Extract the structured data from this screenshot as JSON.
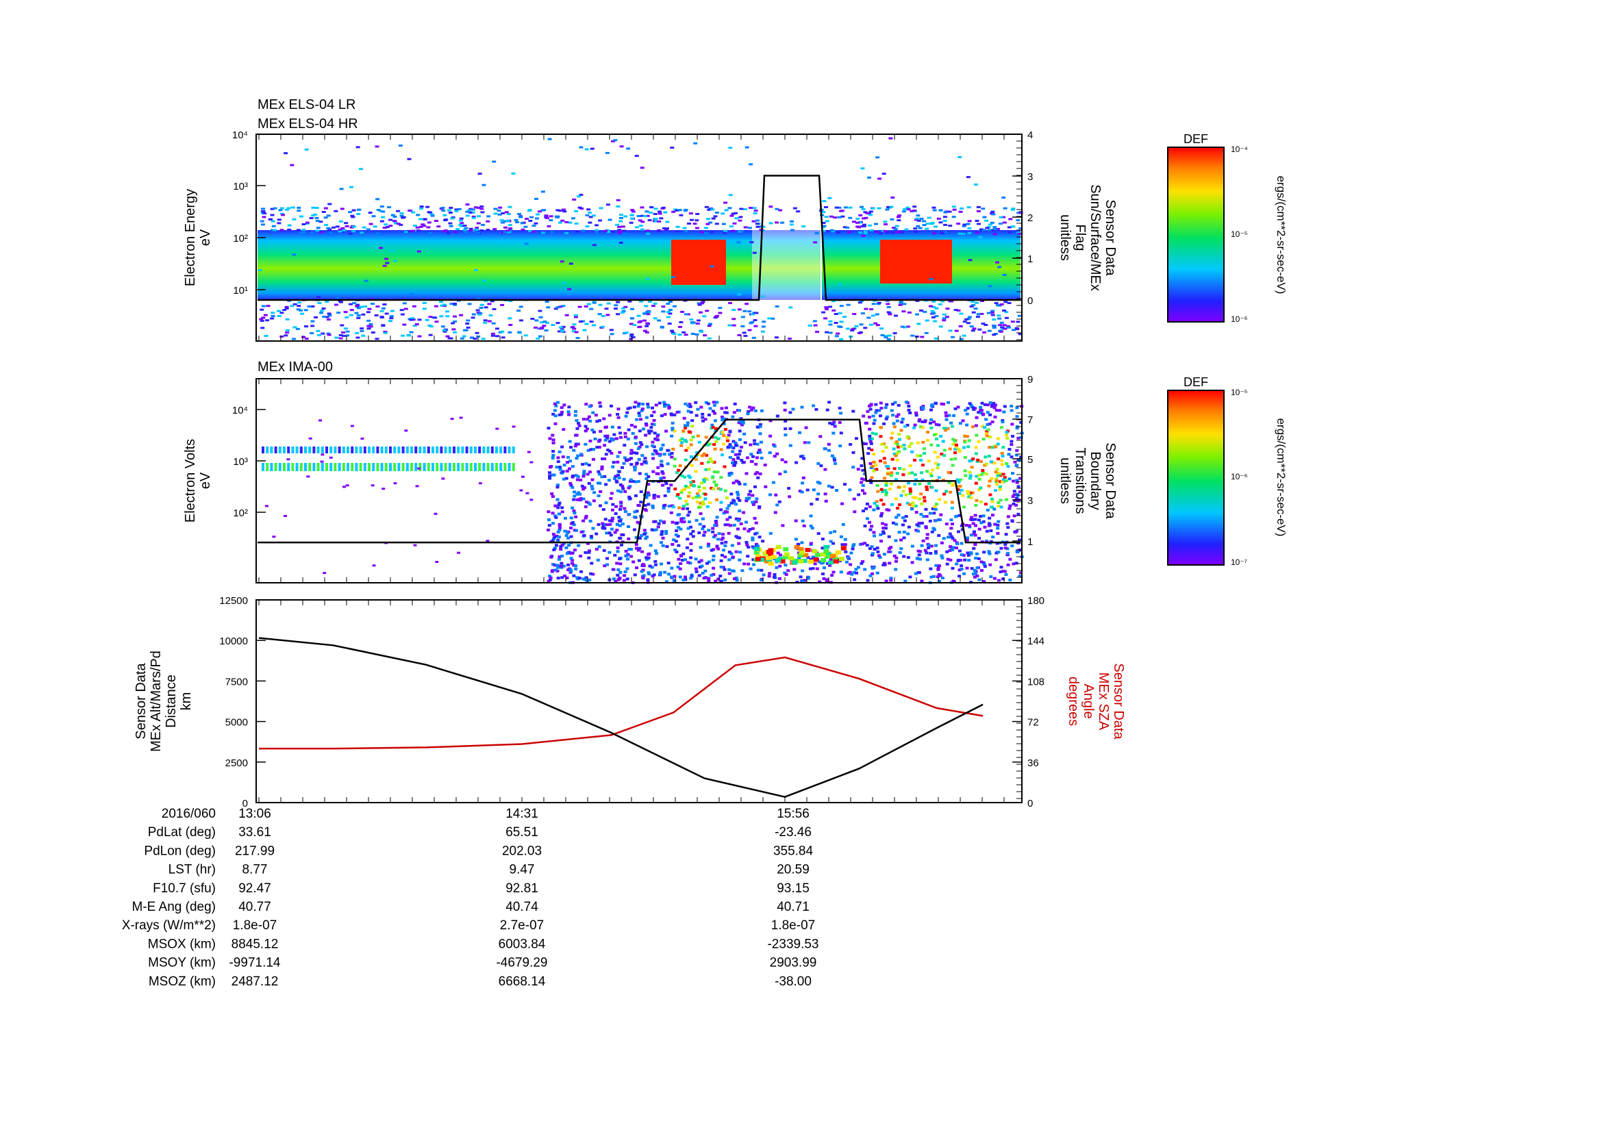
{
  "panel1": {
    "titles": [
      "MEx ELS-04 LR",
      "MEx ELS-04 HR"
    ],
    "ylabel": [
      "Electron Energy",
      "eV"
    ],
    "y_ticks": [
      "10¹",
      "10²",
      "10³",
      "10⁴"
    ],
    "right_ticks": [
      "0",
      "1",
      "2",
      "3",
      "4"
    ],
    "right_label": [
      "Sensor Data",
      "Sun/Surface/MEx",
      "Flag",
      "unitless"
    ],
    "colorbar": {
      "title": "DEF",
      "ticks": [
        "10⁻⁴",
        "10⁻⁵",
        "10⁻⁶"
      ],
      "units": "ergs/(cm**2-sr-sec-eV)"
    }
  },
  "panel2": {
    "title": "MEx IMA-00",
    "ylabel": [
      "Electron Volts",
      "eV"
    ],
    "y_ticks": [
      "10²",
      "10³",
      "10⁴"
    ],
    "right_ticks": [
      "1",
      "3",
      "5",
      "7",
      "9"
    ],
    "right_label": [
      "Sensor Data",
      "Boundary",
      "Transitions",
      "unitless"
    ],
    "colorbar": {
      "title": "DEF",
      "ticks": [
        "10⁻⁵",
        "10⁻⁶",
        "10⁻⁷"
      ],
      "units": "ergs/(cm**2-sr-sec-eV)"
    }
  },
  "panel3": {
    "left_ticks": [
      "0",
      "2500",
      "5000",
      "7500",
      "10000",
      "12500"
    ],
    "right_ticks": [
      "0",
      "36",
      "72",
      "108",
      "144",
      "180"
    ],
    "left_label": [
      "Sensor Data",
      "MEx Alt/Mars/Pd",
      "Distance",
      "km"
    ],
    "right_label": [
      "Sensor Data",
      "MEx SZA",
      "Angle",
      "degrees"
    ]
  },
  "ephemeris": {
    "labels": [
      "2016/060",
      "PdLat (deg)",
      "PdLon (deg)",
      "LST (hr)",
      "F10.7 (sfu)",
      "M-E Ang (deg)",
      "X-rays (W/m**2)",
      "MSOX (km)",
      "MSOY (km)",
      "MSOZ (km)"
    ],
    "columns": [
      [
        "13:06",
        "33.61",
        "217.99",
        "8.77",
        "92.47",
        "40.77",
        "1.8e-07",
        "8845.12",
        "-9971.14",
        "2487.12"
      ],
      [
        "14:31",
        "65.51",
        "202.03",
        "9.47",
        "92.81",
        "40.74",
        "2.7e-07",
        "6003.84",
        "-4679.29",
        "6668.14"
      ],
      [
        "15:56",
        "-23.46",
        "355.84",
        "20.59",
        "93.15",
        "40.71",
        "1.8e-07",
        "-2339.53",
        "2903.99",
        "-38.00"
      ]
    ]
  },
  "colors": {
    "altitude_line": "#000000",
    "sza_line": "#cc0000",
    "sza_label": "#cc0000"
  },
  "chart_data": [
    {
      "type": "heatmap",
      "title": "MEx ELS-04 LR / MEx ELS-04 HR",
      "ylabel": "Electron Energy eV",
      "yscale": "log",
      "series": [
        {
          "name": "Sun/Surface/MEx Flag",
          "x": [
            "13:06",
            "14:31",
            "15:30",
            "15:33",
            "15:48",
            "15:51",
            "17:00"
          ],
          "y": [
            0,
            0,
            0,
            3,
            3,
            0,
            0
          ]
        }
      ],
      "right_ylim": [
        0,
        4
      ]
    },
    {
      "type": "heatmap",
      "title": "MEx IMA-00",
      "ylabel": "Electron Volts eV",
      "yscale": "log",
      "series": [
        {
          "name": "Boundary Transitions",
          "x": [
            "13:06",
            "14:55",
            "15:06",
            "15:20",
            "15:28",
            "16:00",
            "16:10",
            "16:30",
            "16:36",
            "17:00"
          ],
          "y": [
            1,
            1,
            4,
            4,
            7,
            7,
            4,
            4,
            1,
            1
          ]
        }
      ],
      "right_ylim": [
        0,
        9
      ]
    },
    {
      "type": "line",
      "xlabel": "",
      "x_ticks": [
        "13:06",
        "14:31",
        "15:56"
      ],
      "series": [
        {
          "name": "MEx Alt/Mars/Pd Distance",
          "axis": "left",
          "units": "km",
          "x": [
            "13:06",
            "13:30",
            "14:00",
            "14:31",
            "15:00",
            "15:30",
            "15:56",
            "16:20",
            "16:45",
            "17:00"
          ],
          "y": [
            10150,
            9700,
            8500,
            6700,
            4300,
            1500,
            350,
            2100,
            4600,
            6050
          ]
        },
        {
          "name": "MEx SZA Angle",
          "axis": "right",
          "units": "degrees",
          "x": [
            "13:06",
            "13:30",
            "14:00",
            "14:31",
            "15:00",
            "15:20",
            "15:40",
            "15:56",
            "16:20",
            "16:45",
            "17:00"
          ],
          "y": [
            48,
            48,
            49,
            52,
            60,
            80,
            122,
            129,
            110,
            84,
            77
          ]
        }
      ],
      "ylim_left": [
        0,
        12500
      ],
      "ylim_right": [
        0,
        180
      ]
    }
  ]
}
